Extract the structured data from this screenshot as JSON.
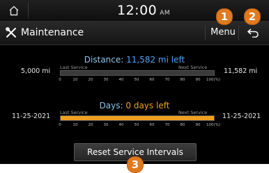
{
  "status_bar": {
    "time": "12:00",
    "ampm": "AM"
  },
  "header": {
    "title": "Maintenance",
    "menu_label": "Menu"
  },
  "callouts": [
    "1",
    "2",
    "3"
  ],
  "distance": {
    "label": "Distance:",
    "value_text": "11,582 mi left",
    "left_value": "5,000 mi",
    "right_value": "11,582 mi",
    "last_label": "Last Service",
    "next_label": "Next Service",
    "progress_percent": 0,
    "fill_color": "#4aa3ff"
  },
  "days": {
    "label": "Days:",
    "value_text": "0 days left",
    "left_value": "11-25-2021",
    "right_value": "11-25-2021",
    "last_label": "Last Service",
    "next_label": "Next Service",
    "progress_percent": 100,
    "fill_color": "#f0a020"
  },
  "scale_ticks": [
    "0",
    "10",
    "20",
    "30",
    "40",
    "50",
    "60",
    "70",
    "80",
    "90",
    "100(%)"
  ],
  "reset_label": "Reset Service Intervals",
  "colors": {
    "accent_orange": "#e07a1f",
    "distance_blue": "#4aa3ff",
    "days_orange": "#f0a020"
  }
}
